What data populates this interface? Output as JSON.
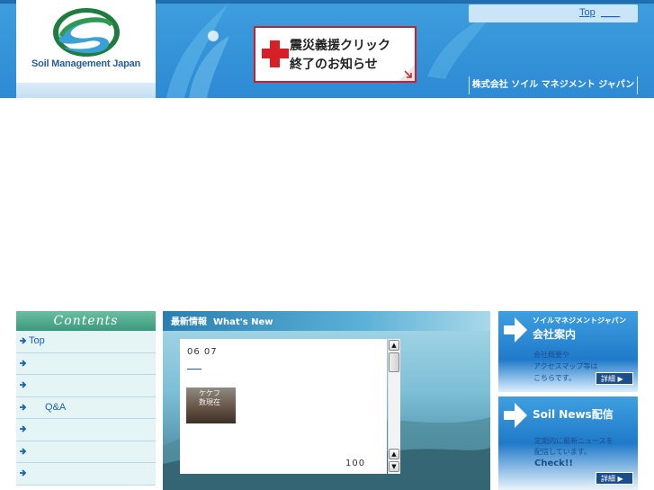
{
  "header": {
    "logo_text": "Soil Management Japan",
    "top_link": "Top",
    "top_link_ext": "____",
    "banner_line1": "震災義援クリック",
    "banner_line2": "終了のお知らせ",
    "company_name": "株式会社 ソイル マネジメント ジャパン"
  },
  "sidebar": {
    "title": "Contents",
    "items": [
      {
        "label": "Top"
      },
      {
        "label": ""
      },
      {
        "label": ""
      },
      {
        "label": "Q&A"
      },
      {
        "label": ""
      },
      {
        "label": ""
      },
      {
        "label": ""
      }
    ]
  },
  "news": {
    "title_ja": "最新情報",
    "title_en": "What's New",
    "date": "06 07",
    "image_caption1": "ケケフ",
    "image_caption2": "数現在",
    "count": "100"
  },
  "right": {
    "box1": {
      "subtitle": "ソイルマネジメントジャパン",
      "title": "会社案内",
      "line1": "会社概要や",
      "line2": "アクセスマップ等は",
      "line3": "こちらです。",
      "detail": "詳細"
    },
    "box2": {
      "title": "Soil News配信",
      "line1": "定期的に最新ニュースを",
      "line2": "配信しています。",
      "line3": "Check!!",
      "detail": "詳細"
    }
  },
  "colors": {
    "header_blue": "#2d8ad4",
    "link_blue": "#1a5fb4",
    "banner_red": "#cc1f2a",
    "nav_bg": "#e5f5f6",
    "contents_green": "#3a9a7b"
  },
  "icons": [
    "cross-icon",
    "arrow-right-icon",
    "scroll-up-icon",
    "scroll-down-icon"
  ]
}
